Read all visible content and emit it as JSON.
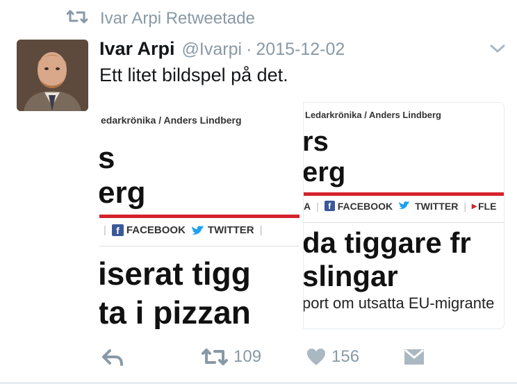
{
  "retweet_context": {
    "text": "Ivar Arpi Retweetade",
    "icon": "retweet-icon"
  },
  "tweet": {
    "author_name": "Ivar Arpi",
    "author_handle": "@Ivarpi",
    "separator": "·",
    "date": "2015-12-02",
    "text": "Ett litet bildspel på det."
  },
  "media": {
    "left": {
      "crumb": "edarkrönika / Anders Lindberg",
      "big1": "s",
      "big2": "erg",
      "facebook": "FACEBOOK",
      "twitter": "TWITTER",
      "headline1": "iserat tigg",
      "headline2": "ta i pizzan"
    },
    "right": {
      "crumb": "Ledarkrönika / Anders Lindberg",
      "big1": "rs",
      "big2": "erg",
      "share_prefix": "A",
      "facebook": "FACEBOOK",
      "twitter": "TWITTER",
      "more": "FLE",
      "headline1": "da tiggare fr",
      "headline2": "slingar",
      "subline": "port om utsatta EU-migrante"
    }
  },
  "actions": {
    "reply_icon": "reply-icon",
    "retweet_icon": "retweet-icon",
    "retweet_count": "109",
    "like_icon": "heart-icon",
    "like_count": "156",
    "message_icon": "envelope-icon"
  },
  "colors": {
    "muted": "#8899a6",
    "text": "#14171a",
    "accent_red": "#d4222b",
    "facebook": "#3b5998",
    "twitter": "#1da1f2"
  }
}
